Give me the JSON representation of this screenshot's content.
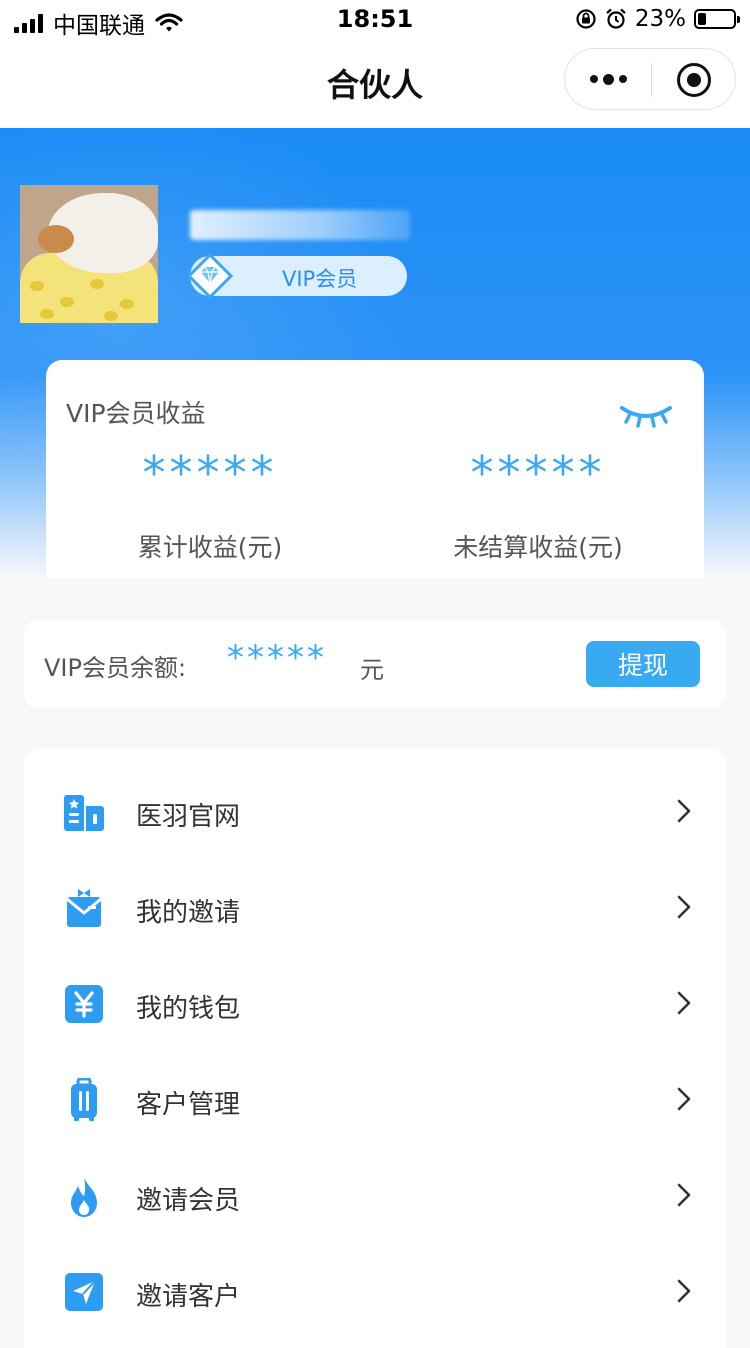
{
  "status_bar": {
    "carrier": "中国联通",
    "time": "18:51",
    "battery": "23%",
    "battery_level": 0.23
  },
  "nav": {
    "title": "合伙人"
  },
  "profile": {
    "vip_label": "VIP会员"
  },
  "earnings": {
    "title": "VIP会员收益",
    "total_value": "*****",
    "total_label": "累计收益(元)",
    "unsettled_value": "*****",
    "unsettled_label": "未结算收益(元)"
  },
  "balance": {
    "label": "VIP会员余额:",
    "value": "*****",
    "unit": "元",
    "withdraw": "提现"
  },
  "menu": {
    "items": [
      {
        "label": "医羽官网",
        "icon": "website-icon"
      },
      {
        "label": "我的邀请",
        "icon": "invitation-icon"
      },
      {
        "label": "我的钱包",
        "icon": "wallet-icon"
      },
      {
        "label": "客户管理",
        "icon": "customer-management-icon"
      },
      {
        "label": "邀请会员",
        "icon": "flame-icon"
      },
      {
        "label": "邀请客户",
        "icon": "send-icon"
      }
    ]
  },
  "colors": {
    "primary": "#38aaf1",
    "hero_blue": "#1a8bf6",
    "icon_blue": "#2f9cf3"
  }
}
